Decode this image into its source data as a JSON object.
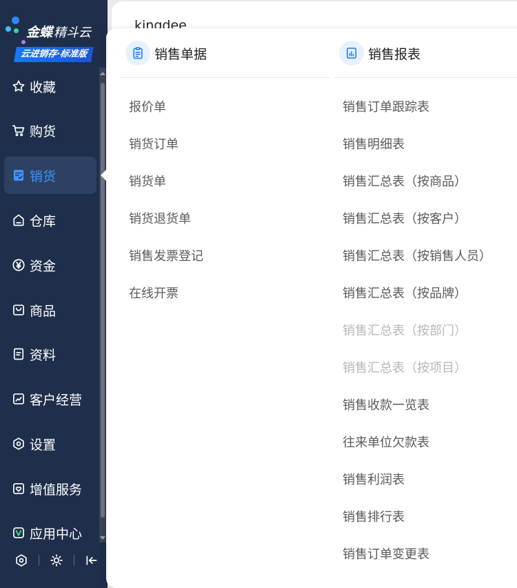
{
  "brand": {
    "name": "金蝶",
    "sub": "精斗云",
    "edition": "云进销存·标准版"
  },
  "header": {
    "text": "kingdee"
  },
  "nav": [
    {
      "label": "收藏",
      "icon": "star-icon",
      "active": false
    },
    {
      "label": "购货",
      "icon": "cart-icon",
      "active": false
    },
    {
      "label": "销货",
      "icon": "sales-doc-icon",
      "active": true
    },
    {
      "label": "仓库",
      "icon": "warehouse-icon",
      "active": false
    },
    {
      "label": "资金",
      "icon": "yen-icon",
      "active": false
    },
    {
      "label": "商品",
      "icon": "goods-icon",
      "active": false
    },
    {
      "label": "资料",
      "icon": "file-icon",
      "active": false
    },
    {
      "label": "客户经营",
      "icon": "chart-icon",
      "active": false
    },
    {
      "label": "设置",
      "icon": "settings-icon",
      "active": false
    },
    {
      "label": "增值服务",
      "icon": "heart-icon",
      "active": false
    },
    {
      "label": "应用中心",
      "icon": "app-icon",
      "active": false
    }
  ],
  "bottom_tools": [
    "settings-icon",
    "sun-icon",
    "collapse-icon"
  ],
  "panel": {
    "left": {
      "title": "销售单据",
      "icon": "clipboard-icon",
      "items": [
        {
          "label": "报价单",
          "disabled": false
        },
        {
          "label": "销货订单",
          "disabled": false
        },
        {
          "label": "销货单",
          "disabled": false
        },
        {
          "label": "销货退货单",
          "disabled": false
        },
        {
          "label": "销售发票登记",
          "disabled": false
        },
        {
          "label": "在线开票",
          "disabled": false
        }
      ]
    },
    "right": {
      "title": "销售报表",
      "icon": "report-icon",
      "items": [
        {
          "label": "销售订单跟踪表",
          "disabled": false
        },
        {
          "label": "销售明细表",
          "disabled": false
        },
        {
          "label": "销售汇总表（按商品）",
          "disabled": false
        },
        {
          "label": "销售汇总表（按客户）",
          "disabled": false
        },
        {
          "label": "销售汇总表（按销售人员）",
          "disabled": false
        },
        {
          "label": "销售汇总表（按品牌）",
          "disabled": false
        },
        {
          "label": "销售汇总表（按部门）",
          "disabled": true
        },
        {
          "label": "销售汇总表（按项目）",
          "disabled": true
        },
        {
          "label": "销售收款一览表",
          "disabled": false
        },
        {
          "label": "往来单位欠款表",
          "disabled": false
        },
        {
          "label": "销售利润表",
          "disabled": false
        },
        {
          "label": "销售排行表",
          "disabled": false
        },
        {
          "label": "销售订单变更表",
          "disabled": false
        }
      ]
    }
  }
}
